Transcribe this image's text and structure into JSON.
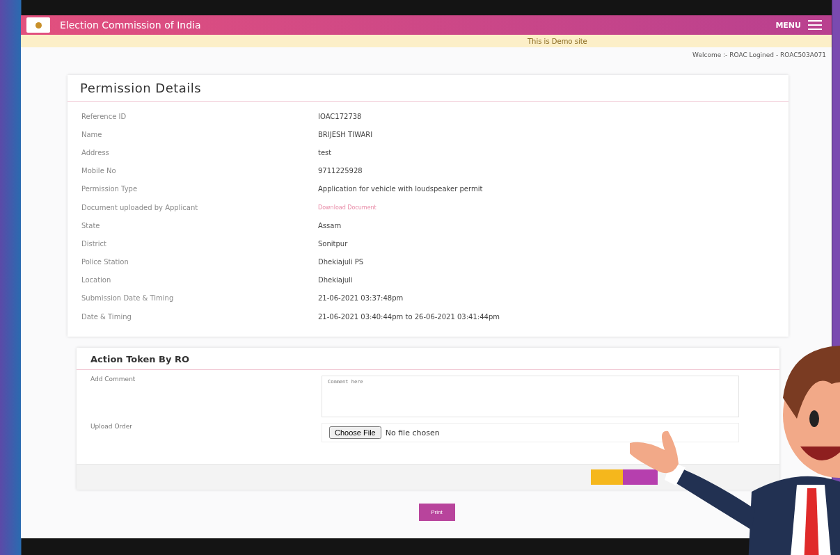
{
  "header": {
    "title": "Election Commission of India",
    "menu_label": "MENU"
  },
  "notice": "This is Demo site",
  "welcome": "Welcome :- ROAC Logined - ROAC503A071",
  "permission_details": {
    "title": "Permission Details",
    "rows": [
      {
        "label": "Reference ID",
        "value": "IOAC172738",
        "kind": "text"
      },
      {
        "label": "Name",
        "value": "BRIJESH TIWARI",
        "kind": "text"
      },
      {
        "label": "Address",
        "value": "test",
        "kind": "text"
      },
      {
        "label": "Mobile No",
        "value": "9711225928",
        "kind": "text"
      },
      {
        "label": "Permission Type",
        "value": "Application for vehicle with loudspeaker permit",
        "kind": "text"
      },
      {
        "label": "Document uploaded by Applicant",
        "value": "Download Document",
        "kind": "link"
      },
      {
        "label": "State",
        "value": "Assam",
        "kind": "text"
      },
      {
        "label": "District",
        "value": "Sonitpur",
        "kind": "text"
      },
      {
        "label": "Police Station",
        "value": "Dhekiajuli PS",
        "kind": "text"
      },
      {
        "label": "Location",
        "value": "Dhekiajuli",
        "kind": "text"
      },
      {
        "label": "Submission Date & Timing",
        "value": "21-06-2021 03:37:48pm",
        "kind": "text"
      },
      {
        "label": "Date & Timing",
        "value": "21-06-2021 03:40:44pm to 26-06-2021 03:41:44pm",
        "kind": "text"
      }
    ]
  },
  "action": {
    "title": "Action Token By RO",
    "comment_label": "Add Comment",
    "comment_placeholder": "Comment here",
    "upload_label": "Upload Order",
    "choose_file": "Choose File",
    "no_file": "No file chosen"
  },
  "print_button": "Print"
}
